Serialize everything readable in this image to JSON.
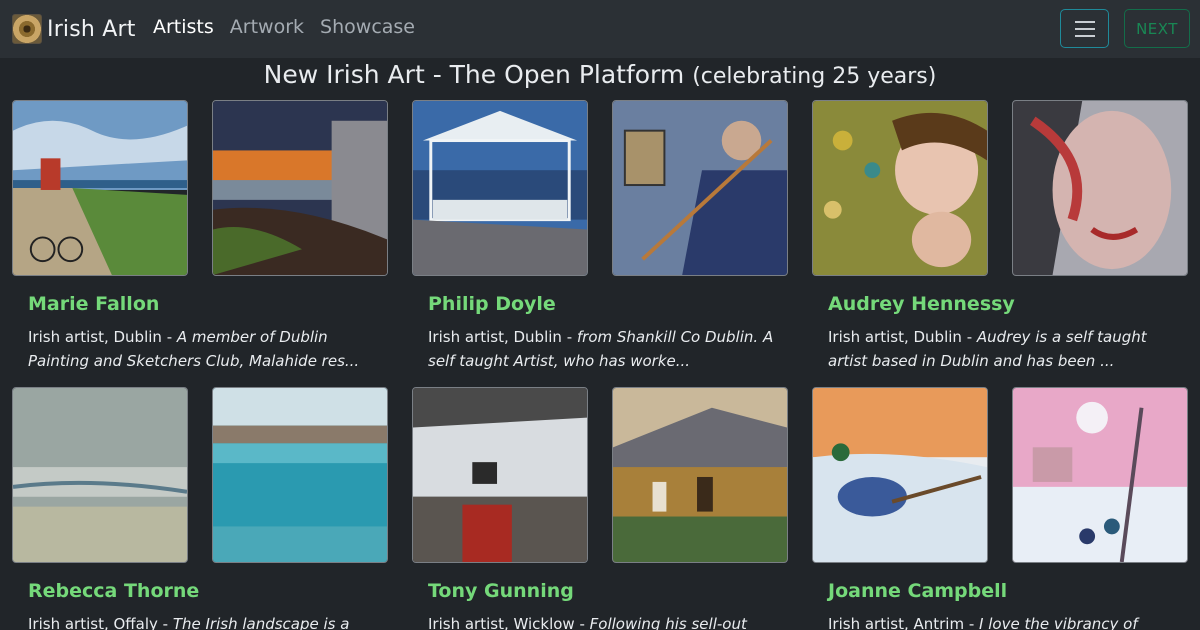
{
  "navbar": {
    "brand": "Irish Art",
    "links": [
      {
        "label": "Artists",
        "active": true
      },
      {
        "label": "Artwork",
        "active": false
      },
      {
        "label": "Showcase",
        "active": false
      }
    ],
    "next_label": "NEXT"
  },
  "title": {
    "main": "New Irish Art - The Open Platform",
    "sub": "(celebrating 25 years)"
  },
  "artists": [
    {
      "name": "Marie Fallon",
      "location": "Irish artist, Dublin",
      "bio": "A member of Dublin Painting and Sketchers Club, Malahide res..."
    },
    {
      "name": "Philip Doyle",
      "location": "Irish artist, Dublin",
      "bio": "from Shankill Co Dublin. A self taught Artist, who has worke..."
    },
    {
      "name": "Audrey Hennessy",
      "location": "Irish artist, Dublin",
      "bio": "Audrey is a self taught artist based in Dublin and has been ..."
    },
    {
      "name": "Rebecca Thorne",
      "location": "Irish artist, Offaly",
      "bio": "The Irish landscape is a"
    },
    {
      "name": "Tony Gunning",
      "location": "Irish artist, Wicklow",
      "bio": "Following his sell-out debut"
    },
    {
      "name": "Joanne Campbell",
      "location": "Irish artist, Antrim",
      "bio": "I love the vibrancy of acrylic"
    }
  ],
  "colors": {
    "background": "#212529",
    "navbar": "#2b3035",
    "artist_name": "#75d97a",
    "next_button": "#198754",
    "toggler_border": "#1f8a9a"
  }
}
